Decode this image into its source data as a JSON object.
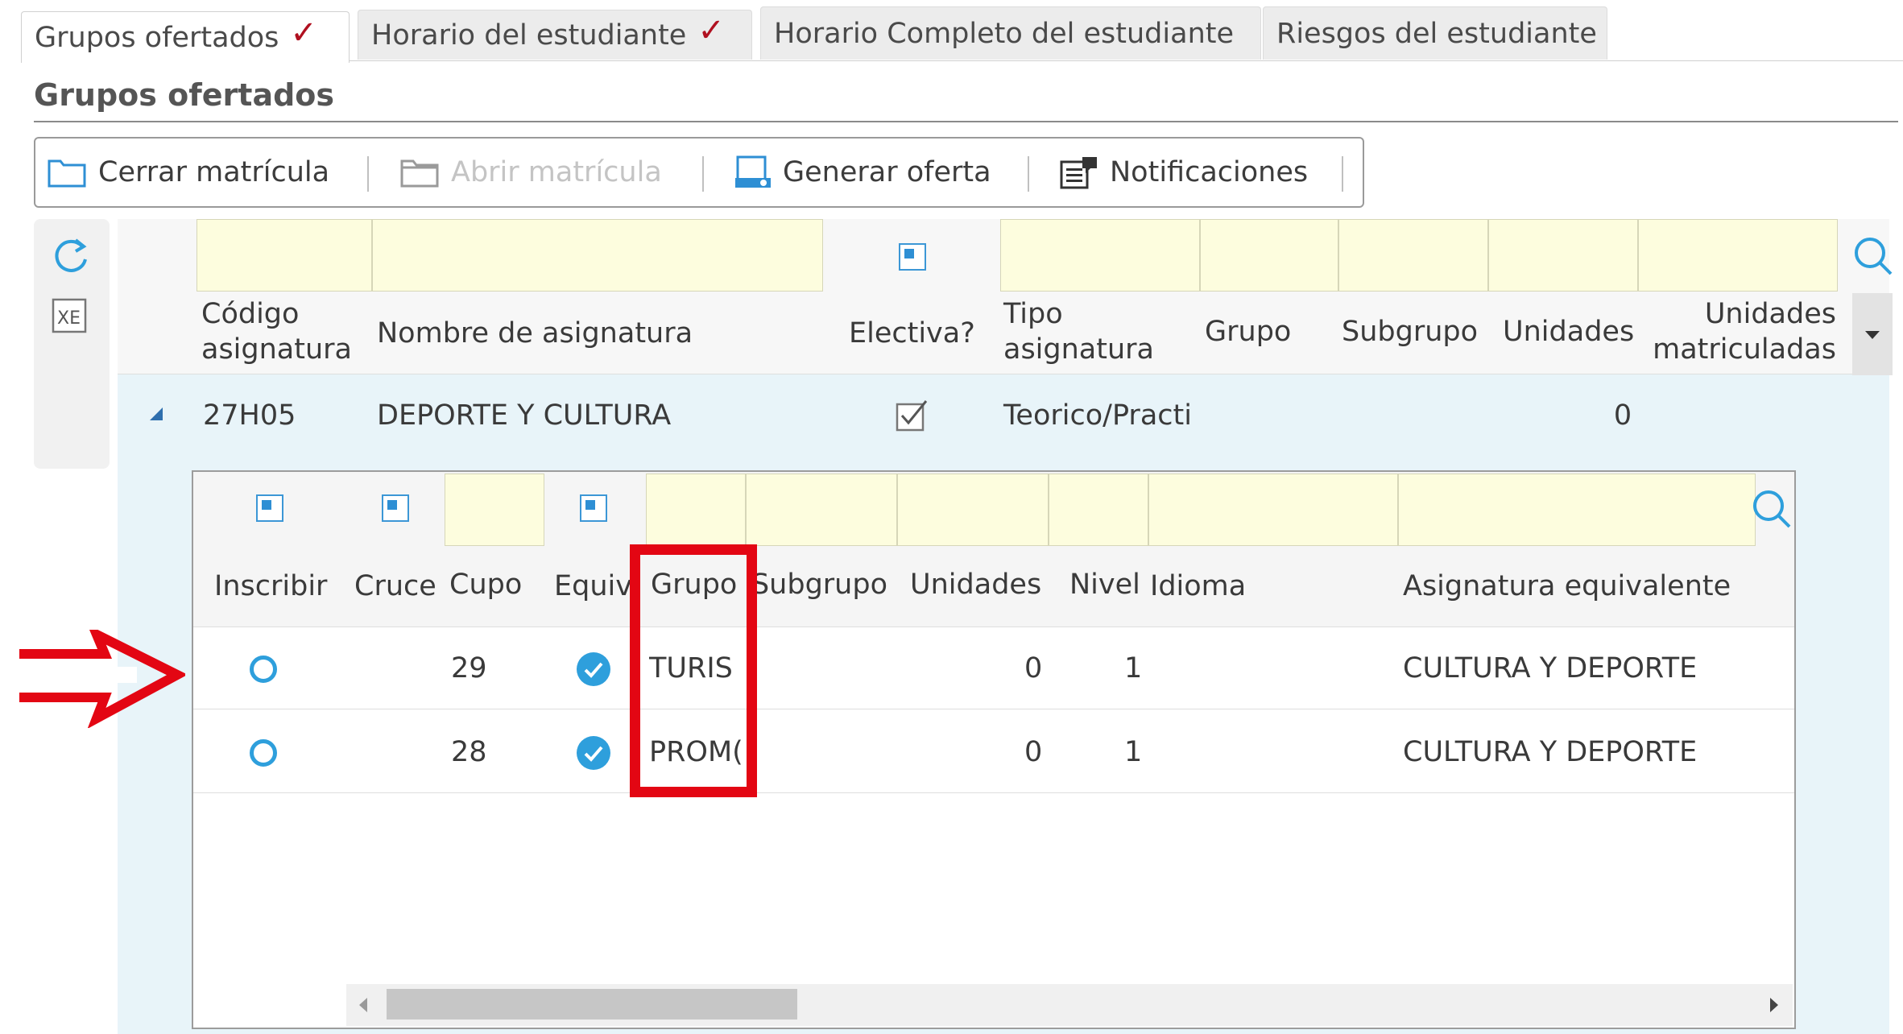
{
  "tabs": [
    {
      "label": "Grupos ofertados",
      "checked": true,
      "active": true
    },
    {
      "label": "Horario del estudiante",
      "checked": true,
      "active": false
    },
    {
      "label": "Horario Completo del estudiante",
      "checked": false,
      "active": false
    },
    {
      "label": "Riesgos del estudiante",
      "checked": false,
      "active": false
    }
  ],
  "section_title": "Grupos ofertados",
  "toolbar": {
    "close_enrollment": "Cerrar matrícula",
    "open_enrollment": "Abrir matrícula",
    "open_enrollment_disabled": true,
    "generate_offer": "Generar oferta",
    "notifications": "Notificaciones"
  },
  "main_grid": {
    "headers": {
      "code": [
        "Código",
        "asignatura"
      ],
      "name": "Nombre de asignatura",
      "elective": "Electiva?",
      "type": [
        "Tipo",
        "asignatura"
      ],
      "group": "Grupo",
      "subgroup": "Subgrupo",
      "units": "Unidades",
      "enrolled_units": [
        "Unidades",
        "matriculadas"
      ]
    },
    "row": {
      "code": "27H05",
      "name": "DEPORTE Y CULTURA",
      "elective": true,
      "type": "Teorico/Practi",
      "enrolled_units": "0"
    }
  },
  "sub_grid": {
    "headers": {
      "enroll": "Inscribir",
      "cross": "Cruce",
      "quota": "Cupo",
      "equiv": "Equiv",
      "group": "Grupo",
      "subgroup": "Subgrupo",
      "units": "Unidades",
      "level": "Nivel",
      "language": "Idioma",
      "equivalent_subject": "Asignatura equivalente"
    },
    "rows": [
      {
        "quota": "29",
        "group": "TURIS",
        "units": "0",
        "level": "1",
        "equivalent_subject": "CULTURA Y DEPORTE"
      },
      {
        "quota": "28",
        "group": "PROM(",
        "units": "0",
        "level": "1",
        "equivalent_subject": "CULTURA Y DEPORTE"
      }
    ]
  },
  "colors": {
    "accent": "#2e9fdc",
    "annotation_red": "#e30613",
    "filter_yellow": "#fdfdde",
    "grid_bg": "#e8f4f9"
  },
  "icons": [
    "check-mark-icon",
    "close-folder-icon",
    "open-folder-icon",
    "generate-offer-icon",
    "notifications-icon",
    "refresh-icon",
    "excel-export-icon",
    "search-icon",
    "expand-triangle-icon",
    "dropdown-arrow-icon",
    "radio-icon",
    "checked-circle-icon",
    "red-arrow-icon"
  ]
}
